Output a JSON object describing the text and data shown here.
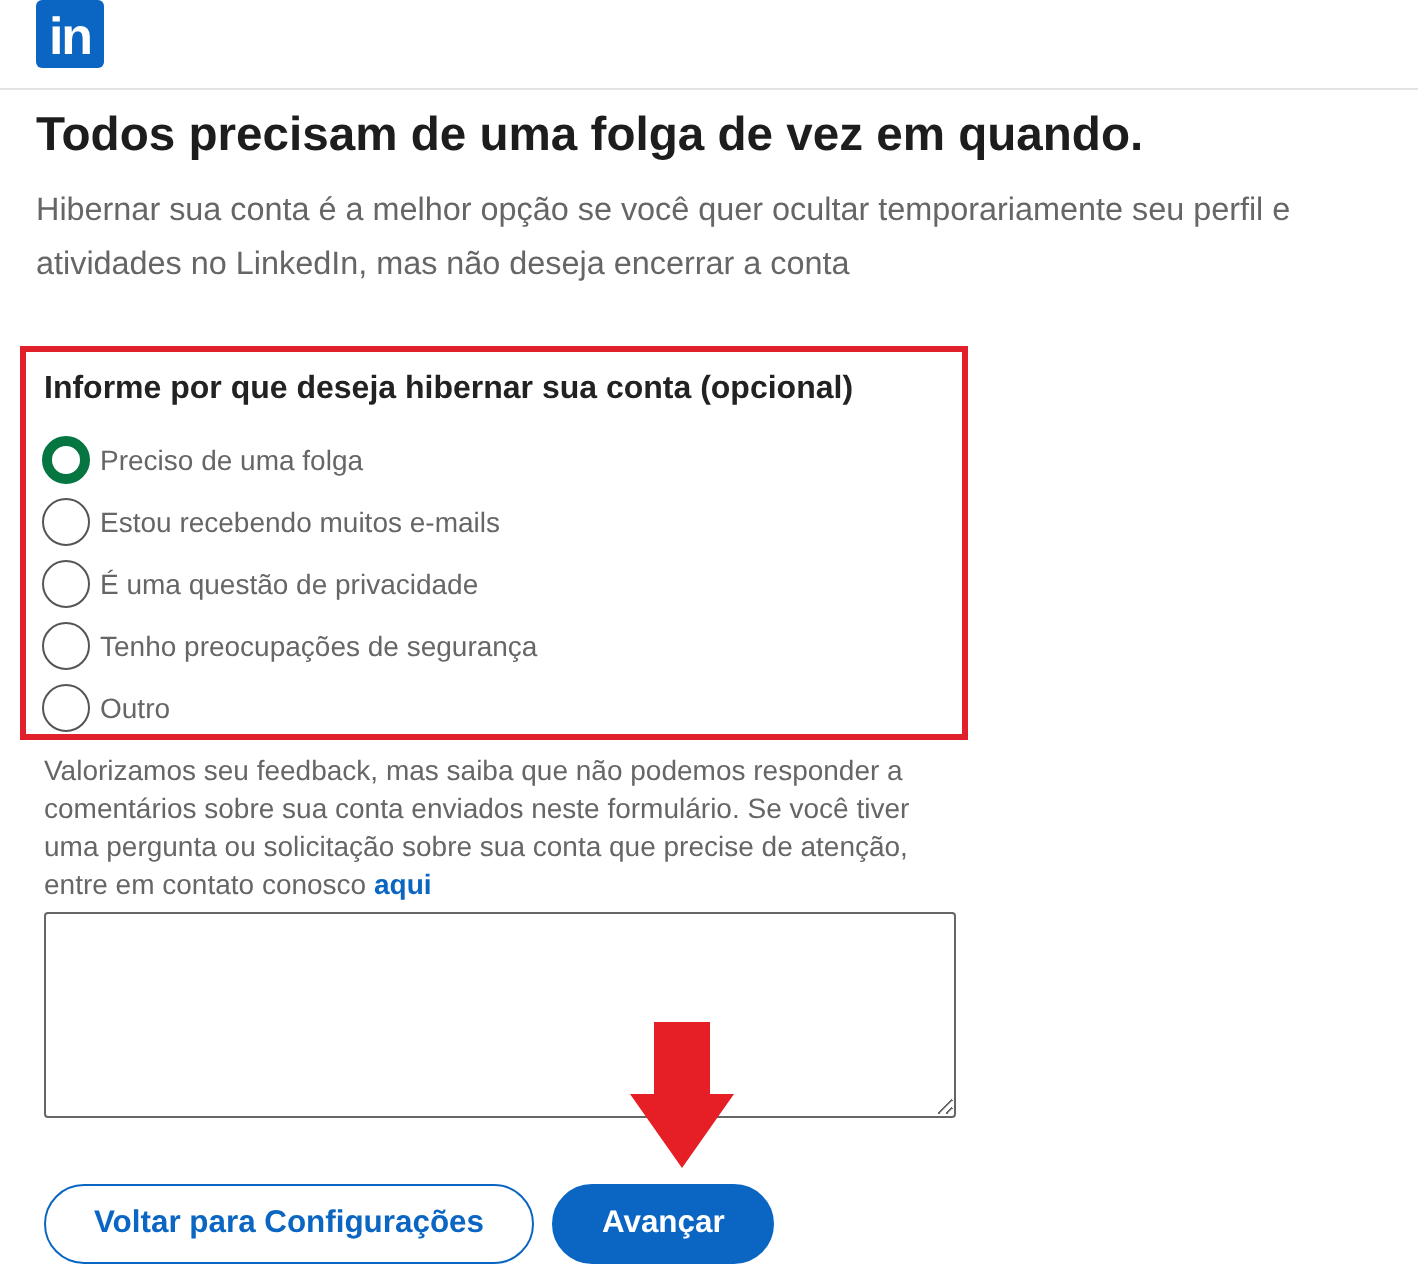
{
  "header": {
    "logo": "in"
  },
  "title": "Todos precisam de uma folga de vez em quando.",
  "description": "Hibernar sua conta é a melhor opção se você quer ocultar temporariamente seu perfil e atividades no LinkedIn, mas não deseja encerrar a conta",
  "reasons": {
    "heading": "Informe por que deseja hibernar sua conta (opcional)",
    "highlighted": true,
    "options": [
      {
        "label": "Preciso de uma folga",
        "selected": true
      },
      {
        "label": "Estou recebendo muitos e-mails",
        "selected": false
      },
      {
        "label": "É uma questão de privacidade",
        "selected": false
      },
      {
        "label": "Tenho preocupações de segurança",
        "selected": false
      },
      {
        "label": "Outro",
        "selected": false
      }
    ]
  },
  "feedback": {
    "note": "Valorizamos seu feedback, mas saiba que não podemos responder a comentários sobre sua conta enviados neste formulário. Se você tiver uma pergunta ou solicitação sobre sua conta que precise de atenção, entre em contato conosco",
    "link": "aqui"
  },
  "buttons": [
    {
      "label": "Voltar para Configurações",
      "kind": "secondary",
      "highlighted": false
    },
    {
      "label": "Avançar",
      "kind": "primary",
      "highlighted": true
    }
  ]
}
